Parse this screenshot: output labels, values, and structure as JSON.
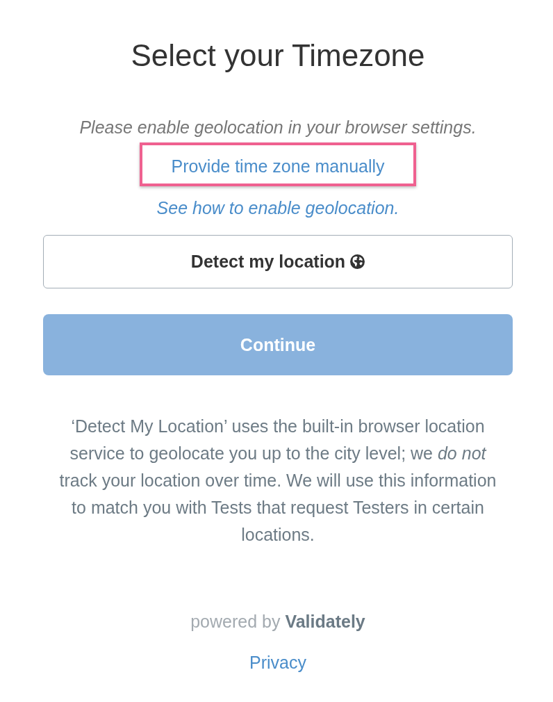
{
  "title": "Select your Timezone",
  "geo_message": "Please enable geolocation in your browser settings.",
  "manual_link": {
    "label": "Provide time zone manually",
    "highlighted": true
  },
  "help_link": "See how to enable geolocation.",
  "detect_button": {
    "label": "Detect my location"
  },
  "continue_button": {
    "label": "Continue",
    "disabled": true
  },
  "disclaimer": "‘Detect My Location’ uses the built-in browser location service to geolocate you up to the city level; we *do not* track your location over time. We will use this information to match you with Tests that request Testers in certain locations.",
  "powered_by": "powered by **Validately**",
  "privacy_link": "Privacy"
}
